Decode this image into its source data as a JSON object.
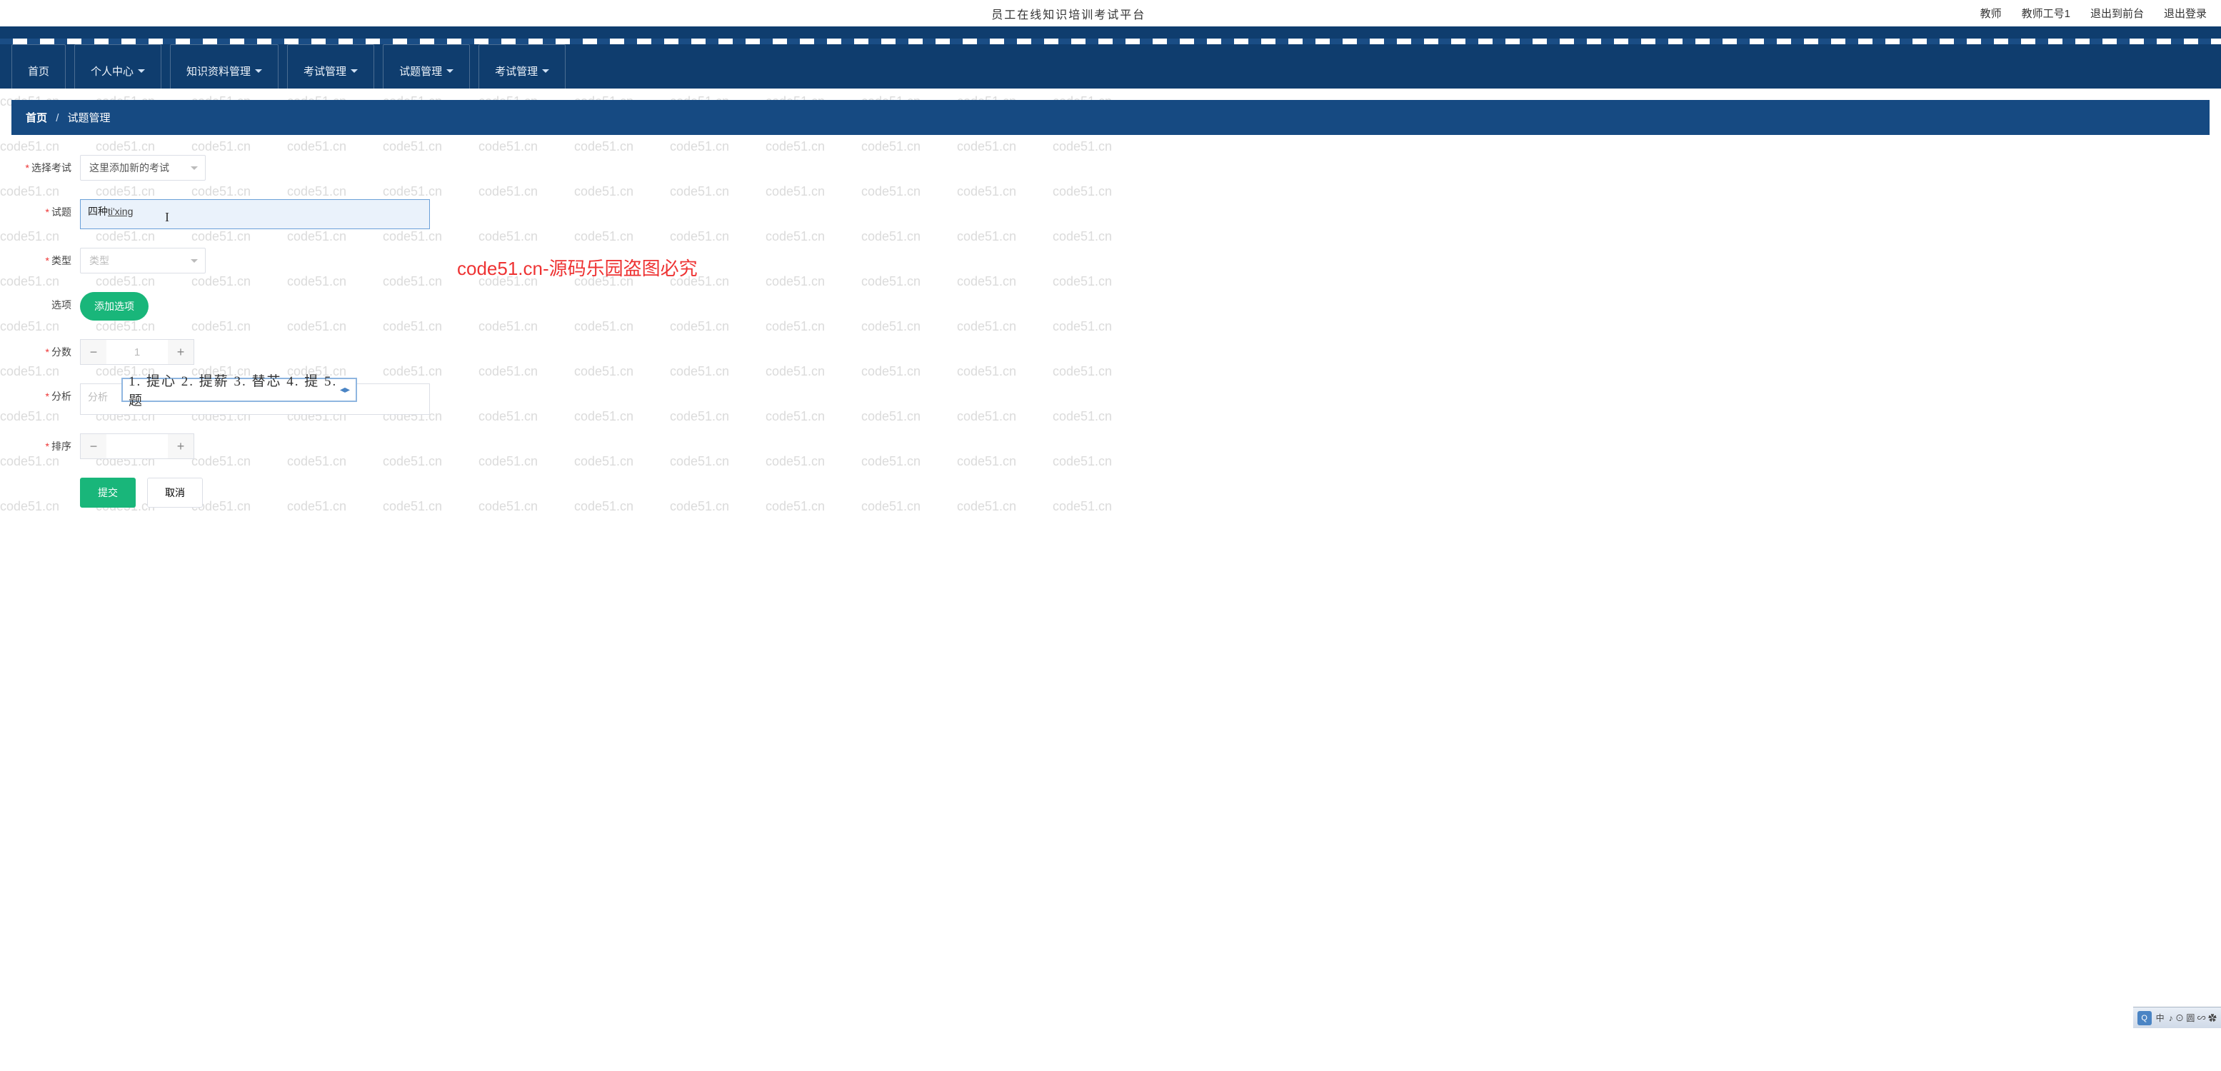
{
  "header": {
    "title": "员工在线知识培训考试平台",
    "user_role": "教师",
    "user_name": "教师工号1",
    "exit_front": "退出到前台",
    "logout": "退出登录"
  },
  "nav": {
    "items": [
      "首页",
      "个人中心",
      "知识资料管理",
      "考试管理",
      "试题管理",
      "考试管理"
    ],
    "has_caret": [
      false,
      true,
      true,
      true,
      true,
      true
    ]
  },
  "breadcrumb": {
    "home": "首页",
    "current": "试题管理"
  },
  "form": {
    "select_exam": {
      "label": "选择考试",
      "value": "这里添加新的考试"
    },
    "question": {
      "label": "试题",
      "prefix": "四种",
      "ime_raw": "ti'xing"
    },
    "ime_candidates": "1. 提心  2. 提薪  3. 替芯  4. 提  5. 题",
    "type": {
      "label": "类型",
      "placeholder": "类型"
    },
    "options": {
      "label": "选项",
      "add_btn": "添加选项"
    },
    "score": {
      "label": "分数",
      "value": "1"
    },
    "analysis": {
      "label": "分析",
      "placeholder": "分析"
    },
    "sort": {
      "label": "排序",
      "value": ""
    },
    "submit": "提交",
    "cancel": "取消"
  },
  "watermark_text": "code51.cn",
  "center_watermark": "code51.cn-源码乐园盗图必究",
  "taskbar": {
    "ime_mode": "中",
    "extra": "♪ ⊙ 圆 ∽ ✿"
  }
}
